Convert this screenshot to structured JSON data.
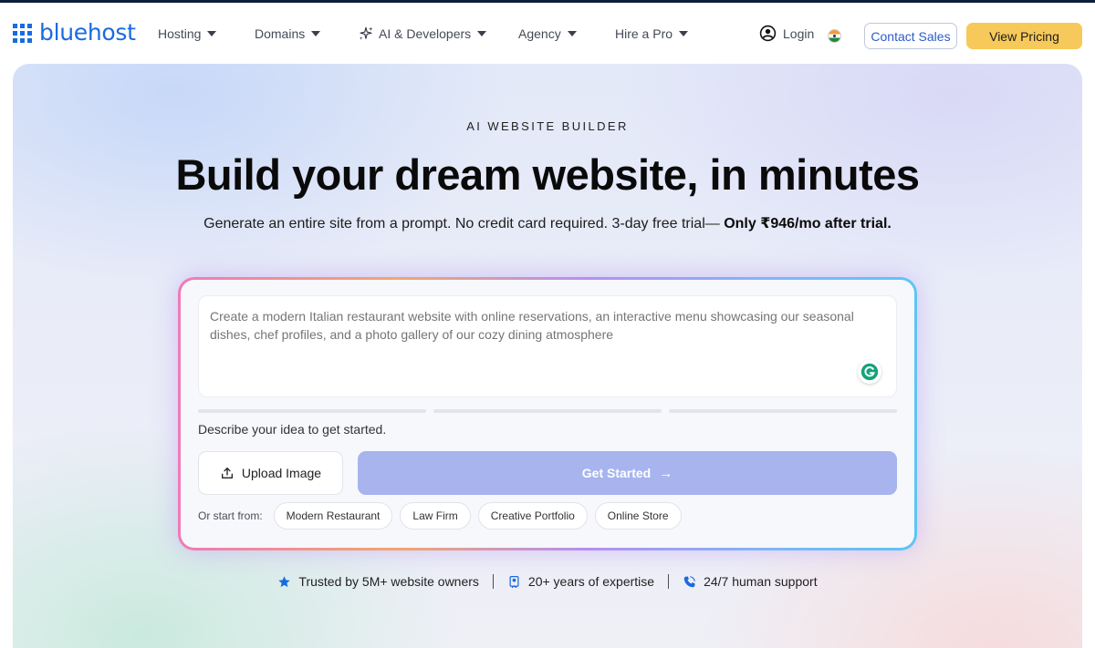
{
  "brand": {
    "name": "bluehost",
    "color": "#196bde"
  },
  "nav": {
    "items": [
      {
        "label": "Hosting",
        "has_dropdown": true
      },
      {
        "label": "Domains",
        "has_dropdown": true
      },
      {
        "label": "AI & Developers",
        "has_dropdown": true,
        "icon": "sparkle-icon"
      },
      {
        "label": "Agency",
        "has_dropdown": true
      },
      {
        "label": "Hire a Pro",
        "has_dropdown": true
      }
    ],
    "login_label": "Login",
    "region_icon": "india-flag-icon",
    "contact_label": "Contact Sales",
    "pricing_label": "View Pricing"
  },
  "hero": {
    "eyebrow": "AI WEBSITE BUILDER",
    "headline": "Build your dream website, in minutes",
    "subline_text": "Generate an entire site from a prompt. No credit card required. 3-day free trial— ",
    "subline_bold": "Only ₹946/mo after trial."
  },
  "builder": {
    "prompt_placeholder": "Create a modern Italian restaurant website with online reservations, an interactive menu showcasing our seasonal dishes, chef profiles, and a photo gallery of our cozy dining atmosphere",
    "hint": "Describe your idea to get started.",
    "upload_label": "Upload Image",
    "start_label": "Get Started",
    "start_arrow": "→",
    "chips_label": "Or start from:",
    "chips": [
      "Modern Restaurant",
      "Law Firm",
      "Creative Portfolio",
      "Online Store"
    ]
  },
  "trust": [
    {
      "label": "Trusted by 5M+ website owners",
      "icon": "star-icon"
    },
    {
      "label": "20+ years of expertise",
      "icon": "badge-icon"
    },
    {
      "label": "24/7 human support",
      "icon": "phone-icon"
    }
  ],
  "colors": {
    "accent_blue": "#196bde",
    "pricing_yellow": "#f7c95a",
    "start_button": "#a7b4ee"
  }
}
